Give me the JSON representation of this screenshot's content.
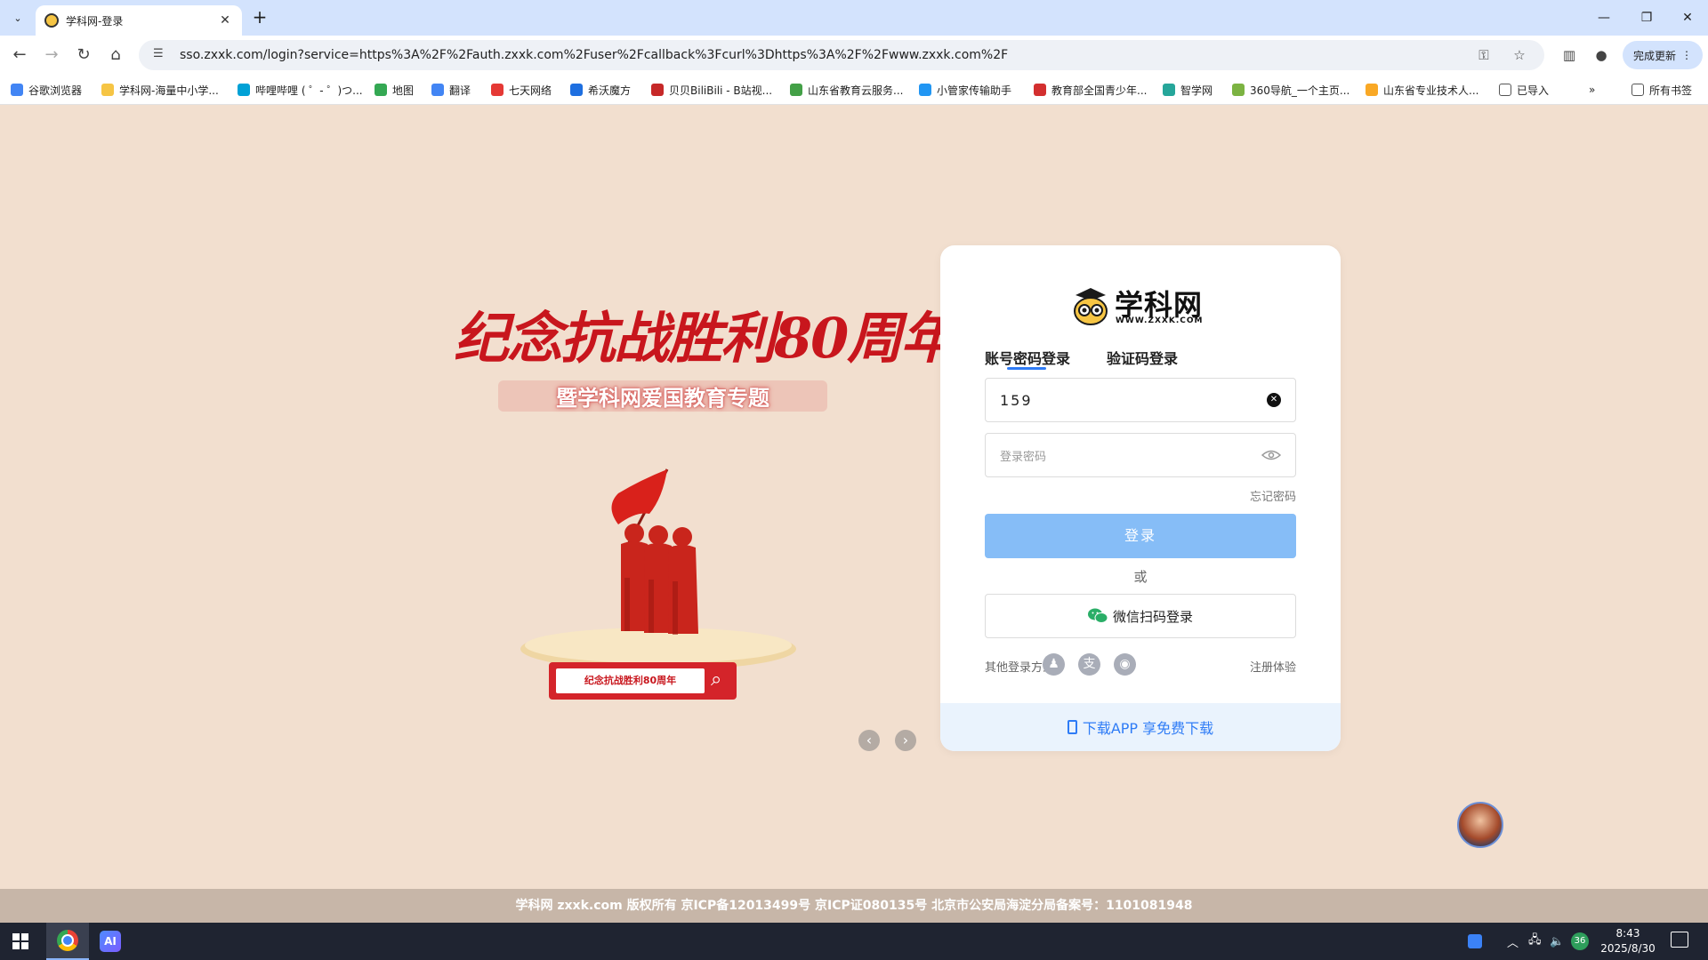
{
  "browser": {
    "tab_title": "学科网-登录",
    "url": "sso.zxxk.com/login?service=https%3A%2F%2Fauth.zxxk.com%2Fuser%2Fcallback%3Fcurl%3Dhttps%3A%2F%2Fwww.zxxk.com%2F",
    "update_label": "完成更新",
    "bookmarks": [
      {
        "label": "谷歌浏览器",
        "color": "#4285f4"
      },
      {
        "label": "学科网-海量中小学...",
        "color": "#f6c544"
      },
      {
        "label": "哔哩哔哩 ( ゜- ゜)つ...",
        "color": "#00a1d6"
      },
      {
        "label": "地图",
        "color": "#34a853"
      },
      {
        "label": "翻译",
        "color": "#4285f4"
      },
      {
        "label": "七天网络",
        "color": "#e53935"
      },
      {
        "label": "希沃魔方",
        "color": "#1e6fe0"
      },
      {
        "label": "贝贝BiliBili - B站视...",
        "color": "#c62828"
      },
      {
        "label": "山东省教育云服务...",
        "color": "#43a047"
      },
      {
        "label": "小管家传输助手",
        "color": "#2196f3"
      },
      {
        "label": "教育部全国青少年...",
        "color": "#d32f2f"
      },
      {
        "label": "智学网",
        "color": "#26a69a"
      },
      {
        "label": "360导航_一个主页...",
        "color": "#7cb342"
      },
      {
        "label": "山东省专业技术人...",
        "color": "#f9a825"
      },
      {
        "label": "已导入",
        "color": "#555555"
      }
    ],
    "bookmarks_more": "»",
    "all_bookmarks": "所有书签"
  },
  "promo": {
    "title": "纪念抗战胜利80周年",
    "subtitle": "暨学科网爱国教育专题",
    "search_text": "纪念抗战胜利80周年"
  },
  "login": {
    "logo_text": "学科网",
    "logo_url": "WWW.ZXXK.COM",
    "tab_password": "账号密码登录",
    "tab_code": "验证码登录",
    "account_value": "159",
    "password_placeholder": "登录密码",
    "forgot": "忘记密码",
    "login_button": "登录",
    "or": "或",
    "wechat_button": "微信扫码登录",
    "other_label": "其他登录方式",
    "register": "注册体验",
    "download": "下载APP 享免费下载",
    "accent_color": "#2f7cf6"
  },
  "footer": {
    "text": "学科网 zxxk.com 版权所有 京ICP备12013499号 京ICP证080135号 北京市公安局海淀分局备案号：1101081948"
  },
  "taskbar": {
    "time": "8:43",
    "date": "2025/8/30",
    "ai_label": "AI",
    "badge": "36"
  }
}
